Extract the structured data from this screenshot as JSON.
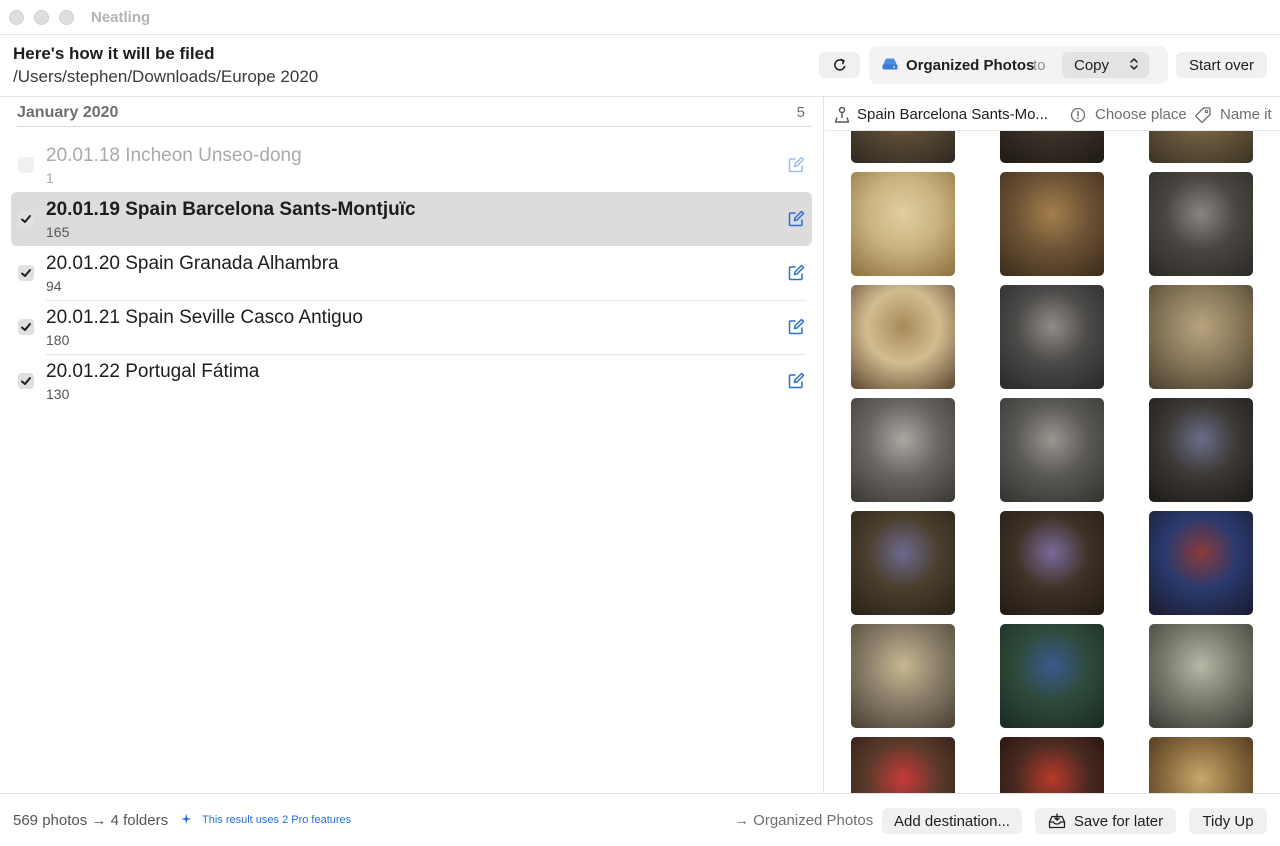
{
  "app": {
    "title": "Neatling"
  },
  "header": {
    "title": "Here's how it will be filed",
    "path": "/Users/stephen/Downloads/Europe 2020",
    "destination": "Organized Photos",
    "to_label": "to",
    "mode": "Copy",
    "start_over": "Start over"
  },
  "group": {
    "month": "January 2020",
    "count": "5"
  },
  "folders": [
    {
      "name": "20.01.18 Incheon Unseo-dong",
      "count": "1",
      "checked": false,
      "selected": false
    },
    {
      "name": "20.01.19 Spain Barcelona Sants-Montjuïc",
      "count": "165",
      "checked": true,
      "selected": true
    },
    {
      "name": "20.01.20 Spain Granada Alhambra",
      "count": "94",
      "checked": true,
      "selected": false
    },
    {
      "name": "20.01.21 Spain Seville Casco Antiguo",
      "count": "180",
      "checked": true,
      "selected": false
    },
    {
      "name": "20.01.22 Portugal Fátima",
      "count": "130",
      "checked": true,
      "selected": false
    }
  ],
  "detail": {
    "place": "Spain Barcelona Sants-Mo...",
    "choose_place": "Choose place",
    "name_it": "Name it"
  },
  "photos": [
    {
      "colors": [
        "#5a4a35",
        "#a08a5e",
        "#2e2820"
      ]
    },
    {
      "colors": [
        "#3a3028",
        "#6b5b48",
        "#1e1a16"
      ]
    },
    {
      "colors": [
        "#6a5a3e",
        "#b09a6a",
        "#3c3224"
      ]
    },
    {
      "colors": [
        "#c9b27e",
        "#e0cfa1",
        "#8c6f3e"
      ]
    },
    {
      "colors": [
        "#6e5436",
        "#a47f4c",
        "#3a2a1a"
      ]
    },
    {
      "colors": [
        "#4a4540",
        "#8a8580",
        "#2c2926"
      ]
    },
    {
      "colors": [
        "#d2bd90",
        "#a88a5a",
        "#5c4630"
      ]
    },
    {
      "colors": [
        "#4c4a48",
        "#8f8c88",
        "#2a2826"
      ]
    },
    {
      "colors": [
        "#8a7a5c",
        "#b8a47e",
        "#4a3e2c"
      ]
    },
    {
      "colors": [
        "#6a6662",
        "#aaa6a0",
        "#3a3632"
      ]
    },
    {
      "colors": [
        "#5a5854",
        "#9a9690",
        "#34322e"
      ]
    },
    {
      "colors": [
        "#3c3834",
        "#6a6e8a",
        "#1c1a18"
      ]
    },
    {
      "colors": [
        "#4a3e2c",
        "#6c6a8e",
        "#2a2218"
      ]
    },
    {
      "colors": [
        "#3e3226",
        "#7a6a9a",
        "#221a14"
      ]
    },
    {
      "colors": [
        "#2a3a6e",
        "#8a3a3a",
        "#1a1a2e"
      ]
    },
    {
      "colors": [
        "#8a7e6a",
        "#c8b890",
        "#4a4032"
      ]
    },
    {
      "colors": [
        "#2e4a3a",
        "#3a5a8e",
        "#1a2a22"
      ]
    },
    {
      "colors": [
        "#7a7a6e",
        "#b8b8a8",
        "#3a3a32"
      ]
    },
    {
      "colors": [
        "#5a3a2a",
        "#c83a3a",
        "#2a1a14"
      ]
    },
    {
      "colors": [
        "#4a2a22",
        "#b83a2a",
        "#1a0e0a"
      ]
    },
    {
      "colors": [
        "#8a6a3e",
        "#c8a86a",
        "#3a2a18"
      ]
    }
  ],
  "footer": {
    "summary": "569 photos → 4 folders",
    "pro_note": "This result uses 2 Pro features",
    "destination": "→ Organized Photos",
    "add_destination": "Add destination...",
    "save_later": "Save for later",
    "tidy_up": "Tidy Up"
  }
}
